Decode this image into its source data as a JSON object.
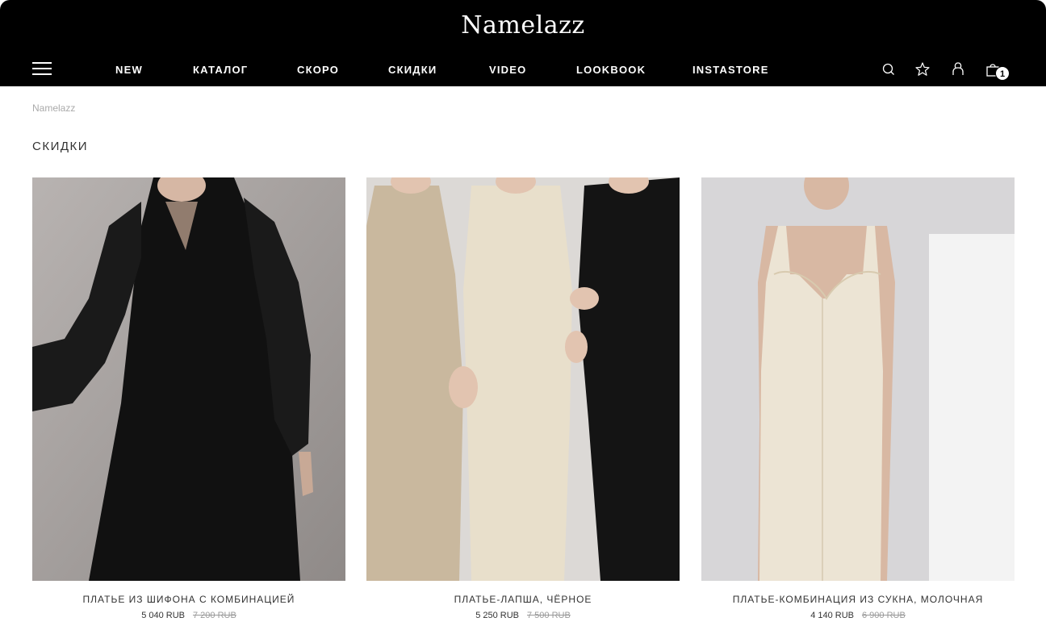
{
  "header": {
    "logo": "Namelazz",
    "nav": [
      "NEW",
      "КАТАЛОГ",
      "СКОРО",
      "СКИДКИ",
      "VIDEO",
      "LOOKBOOK",
      "INSTASTORE"
    ],
    "icons": [
      "menu-icon",
      "search-icon",
      "star-icon",
      "user-icon",
      "bag-icon"
    ],
    "cart_count": "1"
  },
  "breadcrumb": "Namelazz",
  "page_title": "СКИДКИ",
  "products": [
    {
      "name": "ПЛАТЬЕ ИЗ ШИФОНА С КОМБИНАЦИЕЙ",
      "price": "5 040 RUB",
      "old_price": "7 200 RUB"
    },
    {
      "name": "ПЛАТЬЕ-ЛАПША, ЧЁРНОЕ",
      "price": "5 250 RUB",
      "old_price": "7 500 RUB"
    },
    {
      "name": "ПЛАТЬЕ-КОМБИНАЦИЯ ИЗ СУКНА, МОЛОЧНАЯ",
      "price": "4 140 RUB",
      "old_price": "6 900 RUB"
    }
  ],
  "colors": {
    "header_bg": "#000000",
    "text": "#333333",
    "muted": "#999999"
  }
}
